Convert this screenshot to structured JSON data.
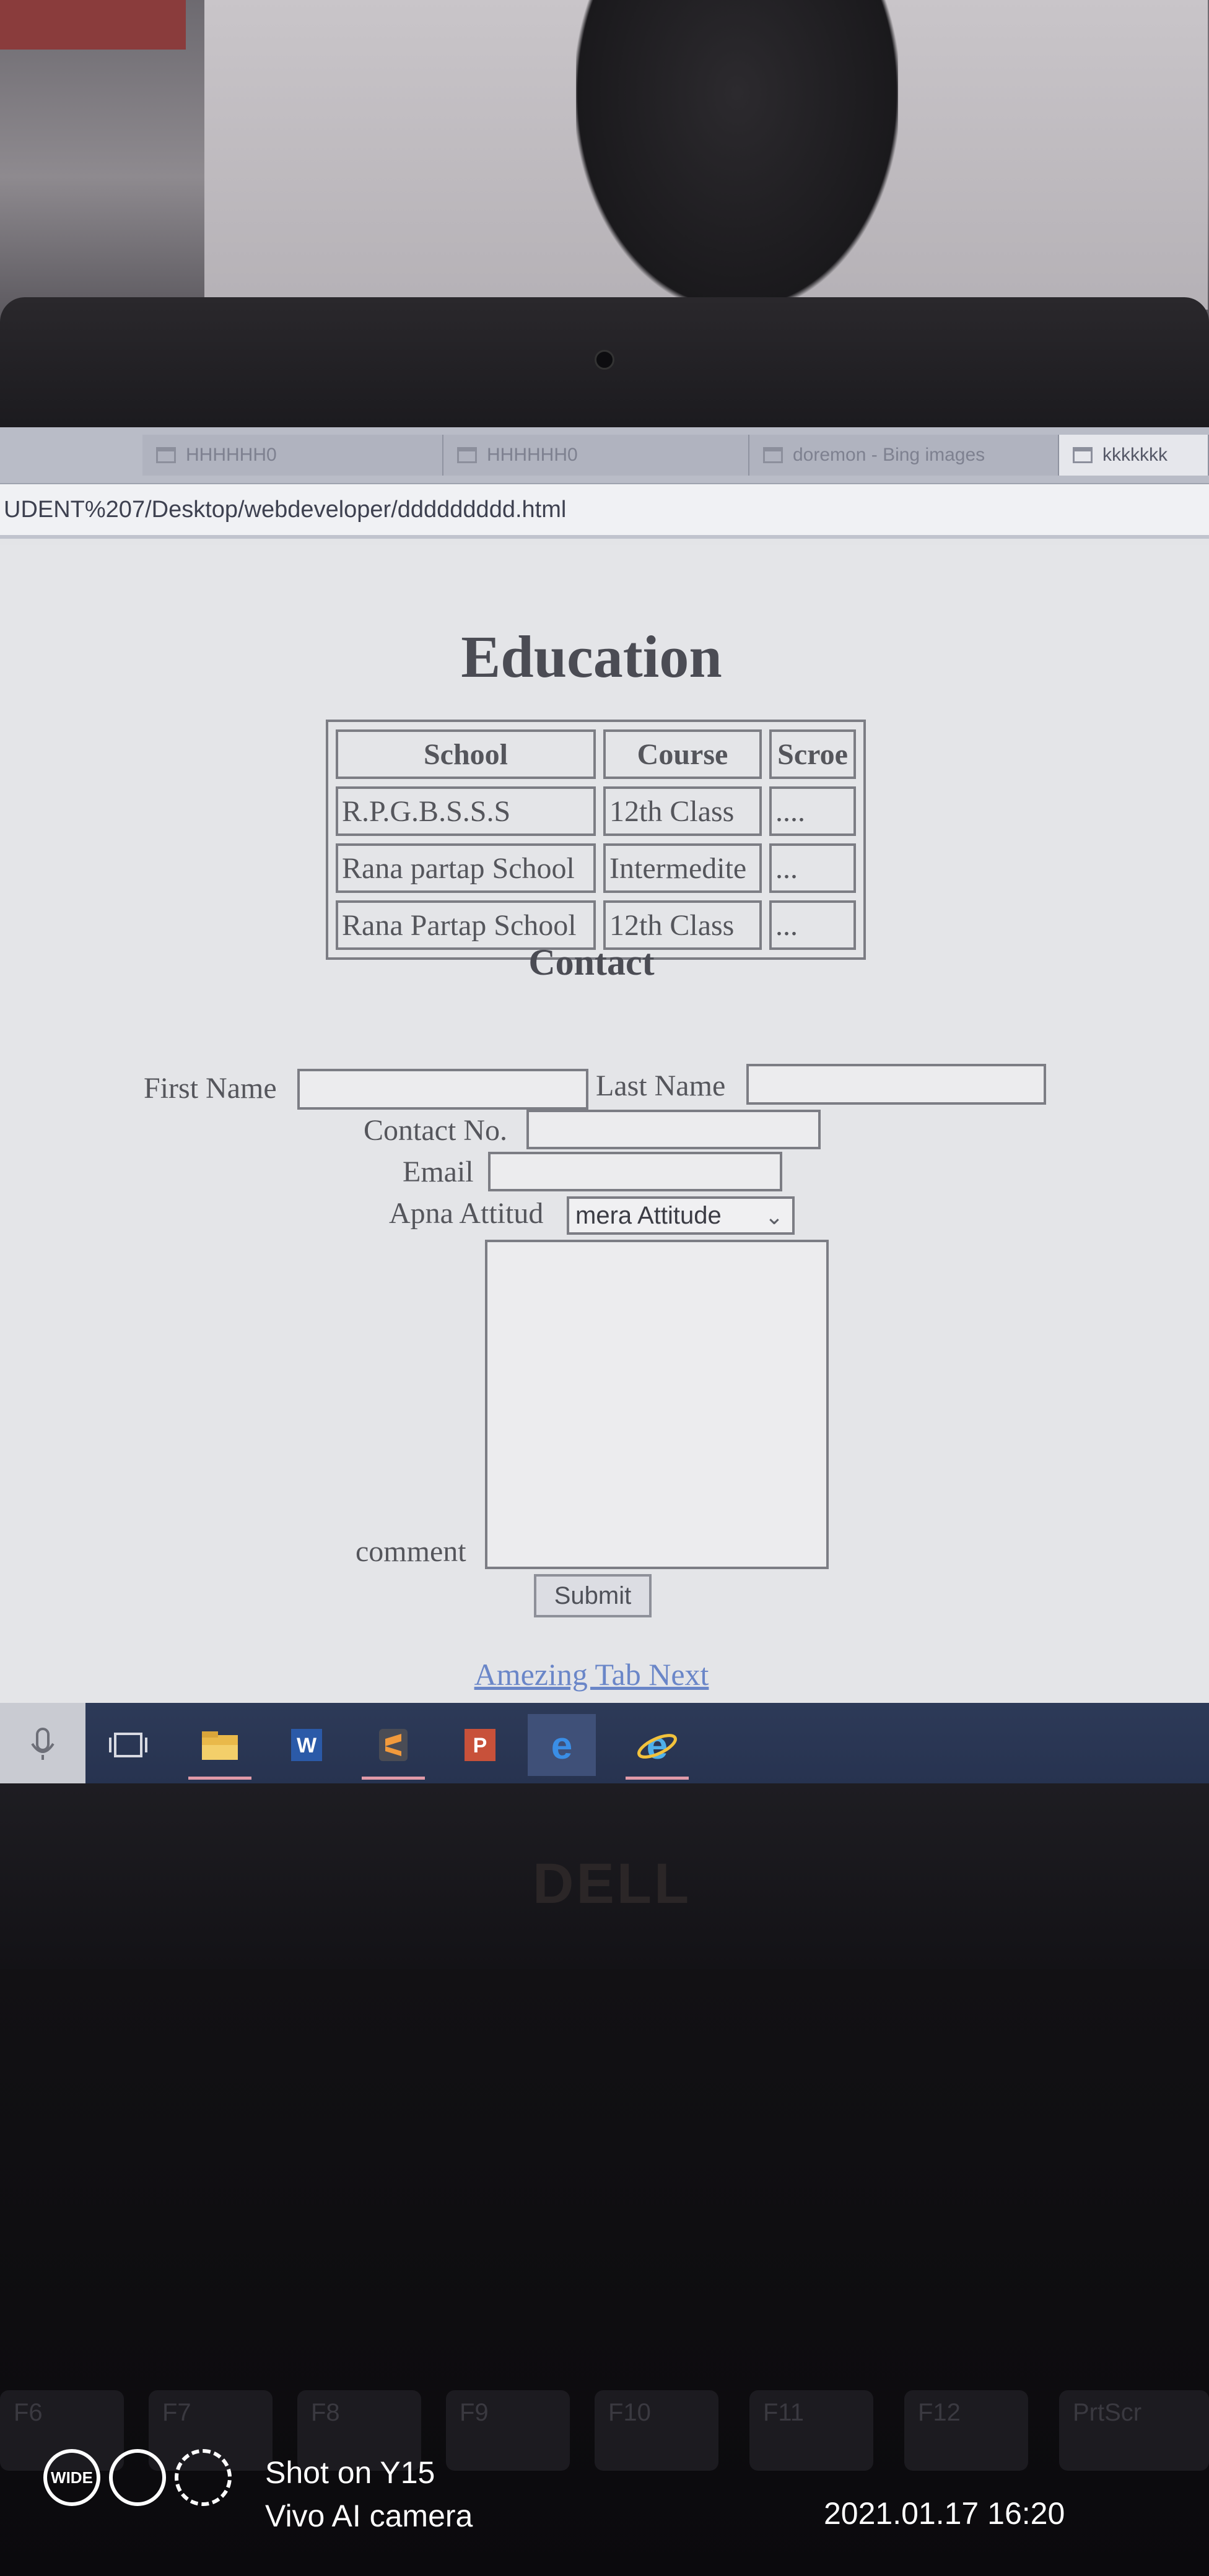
{
  "browser": {
    "tabs": [
      {
        "label": "HHHHHH0"
      },
      {
        "label": "HHHHHH0"
      },
      {
        "label": "doremon - Bing images"
      },
      {
        "label": "kkkkkkk"
      }
    ],
    "address": "UDENT%207/Desktop/webdeveloper/ddddddddd.html"
  },
  "education": {
    "title": "Education",
    "headers": [
      "School",
      "Course",
      "Scroe"
    ],
    "rows": [
      [
        "R.P.G.B.S.S.S",
        "12th Class",
        "...."
      ],
      [
        "Rana partap School",
        "Intermedite",
        "..."
      ],
      [
        "Rana Partap School",
        "12th Class",
        "..."
      ]
    ]
  },
  "contact": {
    "title": "Contact",
    "first_name_label": "First Name",
    "last_name_label": "Last Name",
    "contact_no_label": "Contact No.",
    "email_label": "Email",
    "attitude_label": "Apna Attitud",
    "attitude_selected": "mera Attitude",
    "comment_label": "comment",
    "submit_label": "Submit"
  },
  "link": {
    "label": "Amezing Tab Next"
  },
  "taskbar": {
    "items": [
      "microphone-icon",
      "task-view-icon",
      "file-explorer-icon",
      "word-icon",
      "sublime-text-icon",
      "powerpoint-icon",
      "edge-icon",
      "internet-explorer-icon"
    ]
  },
  "laptop": {
    "brand": "DELL",
    "keys": [
      "F6",
      "F7",
      "F8",
      "F9",
      "F10",
      "F11",
      "F12",
      "PrtScr"
    ]
  },
  "camera_watermark": {
    "badge": "WIDE",
    "line1": "Shot on Y15",
    "line2": "Vivo AI camera",
    "datetime": "2021.01.17 16:20"
  },
  "colors": {
    "page_bg": "#e4e5e8",
    "link": "#6a86c8",
    "taskbar": "#2d3a58"
  }
}
